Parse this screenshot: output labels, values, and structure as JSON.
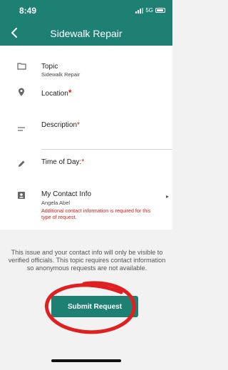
{
  "status_bar": {
    "time": "8:49",
    "network": "5G"
  },
  "header": {
    "title": "Sidewalk Repair",
    "back_icon": "chevron-left-icon"
  },
  "form": {
    "topic": {
      "label": "Topic",
      "value": "Sidewalk Repair",
      "icon": "folder-icon"
    },
    "location": {
      "label": "Location",
      "required_mark": "*",
      "icon": "location-pin-icon"
    },
    "description": {
      "label": "Description",
      "required_mark": "*",
      "icon": "text-lines-icon"
    },
    "time_of_day": {
      "label": "Time of Day:",
      "required_mark": "*",
      "icon": "pencil-icon"
    },
    "contact": {
      "label": "My Contact Info",
      "name": "Angela Abel",
      "error": "Additional contact information is required for this type of request.",
      "icon": "contact-card-icon",
      "chevron": "▸"
    }
  },
  "notice": "This issue and your contact info will only be visible to verified officials. This topic requires contact information so anonymous requests are not available.",
  "submit": {
    "label": "Submit Request"
  },
  "colors": {
    "primary": "#1e7f73",
    "error": "#d32020",
    "annotation": "#e02020"
  }
}
